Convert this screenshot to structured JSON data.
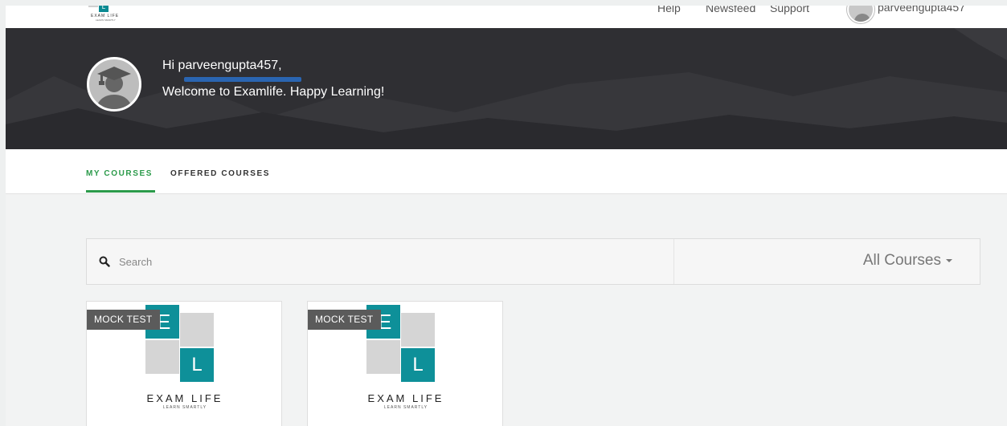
{
  "topnav": {
    "logo_letter": "L",
    "logo_name": "EXAM LIFE",
    "logo_tagline": "LEARN SMARTLY",
    "links": [
      "Help",
      "Newsfeed",
      "Support"
    ],
    "username": "parveengupta457"
  },
  "hero": {
    "greeting": "Hi parveengupta457,",
    "welcome": "Welcome to Examlife. Happy Learning!",
    "bg_color": "#2f2f33"
  },
  "tabs": {
    "my_courses": "MY COURSES",
    "offered_courses": "OFFERED COURSES",
    "active_color": "#2b9a4a"
  },
  "search": {
    "placeholder": "Search",
    "value": "",
    "filter_label": "All Courses"
  },
  "cards": [
    {
      "badge": "MOCK TEST",
      "logo_e": "E",
      "logo_l": "L",
      "brand": "EXAM LIFE",
      "tagline": "LEARN SMARTLY"
    },
    {
      "badge": "MOCK TEST",
      "logo_e": "E",
      "logo_l": "L",
      "brand": "EXAM LIFE",
      "tagline": "LEARN SMARTLY"
    }
  ],
  "accent_teal": "#0e9099"
}
